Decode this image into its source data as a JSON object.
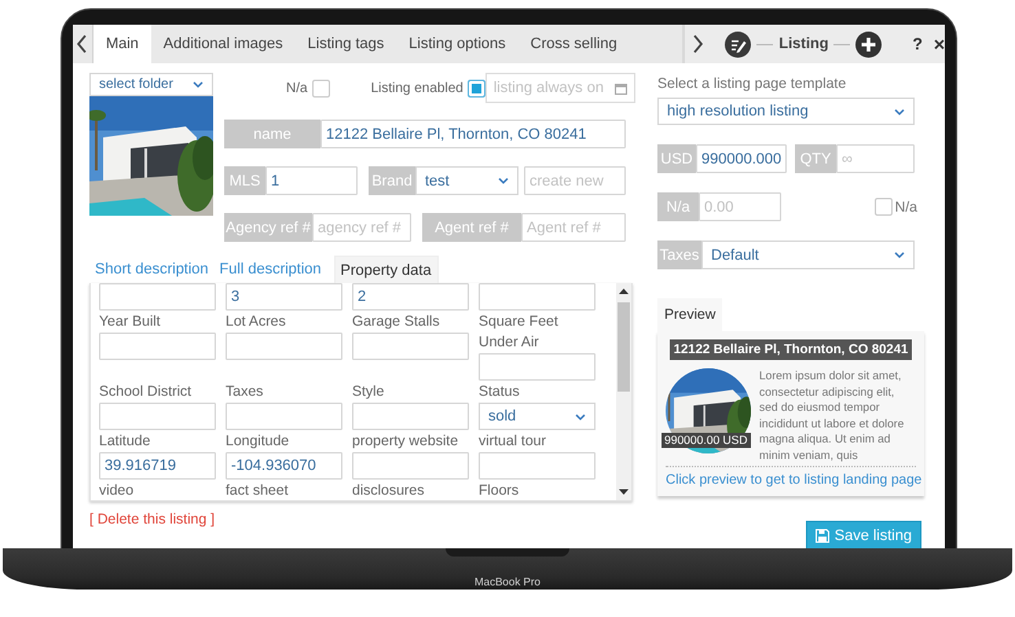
{
  "tabs": [
    {
      "label": "Main",
      "selected": true
    },
    {
      "label": "Additional images",
      "selected": false
    },
    {
      "label": "Listing tags",
      "selected": false
    },
    {
      "label": "Listing options",
      "selected": false
    },
    {
      "label": "Cross selling",
      "selected": false
    }
  ],
  "header": {
    "title": "Listing",
    "help": "?",
    "close": "×"
  },
  "folder_select": {
    "value": "select folder"
  },
  "na_checkbox": {
    "label": "N/a",
    "checked": false
  },
  "enabled_checkbox": {
    "label": "Listing enabled",
    "checked": true
  },
  "availability": {
    "placeholder": "listing always on"
  },
  "name": {
    "label": "name",
    "value": "12122 Bellaire Pl, Thornton, CO 80241"
  },
  "mls": {
    "label": "MLS",
    "value": "1"
  },
  "brand": {
    "label": "Brand",
    "value": "test"
  },
  "new_brand": {
    "placeholder": "create new"
  },
  "agency_ref": {
    "label": "Agency ref #",
    "placeholder": "agency ref #"
  },
  "agent_ref": {
    "label": "Agent ref #",
    "placeholder": "Agent ref #"
  },
  "subtabs": [
    {
      "label": "Short description",
      "selected": false
    },
    {
      "label": "Full description",
      "selected": false
    },
    {
      "label": "Property data",
      "selected": true
    }
  ],
  "property_fields": [
    {
      "kind": "input"
    },
    {
      "kind": "input",
      "value": "3"
    },
    {
      "kind": "input",
      "value": "2"
    },
    {
      "kind": "input"
    },
    {
      "kind": "input",
      "label": "Year Built"
    },
    {
      "kind": "input",
      "label": "Lot Acres"
    },
    {
      "kind": "input",
      "label": "Garage Stalls"
    },
    {
      "kind": "input",
      "label": "Square Feet Under Air"
    },
    {
      "kind": "input",
      "label": "School District"
    },
    {
      "kind": "input",
      "label": "Taxes"
    },
    {
      "kind": "input",
      "label": "Style"
    },
    {
      "kind": "select",
      "label": "Status",
      "value": "sold"
    },
    {
      "kind": "input",
      "label": "Latitude",
      "value": "39.916719"
    },
    {
      "kind": "input",
      "label": "Longitude",
      "value": "-104.936070"
    },
    {
      "kind": "input",
      "label": "property website"
    },
    {
      "kind": "input",
      "label": "virtual tour"
    },
    {
      "kind": "label",
      "label": "video"
    },
    {
      "kind": "label",
      "label": "fact sheet"
    },
    {
      "kind": "label",
      "label": "disclosures"
    },
    {
      "kind": "label",
      "label": "Floors"
    }
  ],
  "delete_link": "[ Delete this listing ]",
  "template": {
    "label": "Select a listing page template",
    "value": "high resolution listing"
  },
  "price": {
    "label": "USD",
    "value": "990000.000"
  },
  "qty": {
    "label": "QTY",
    "placeholder": "∞"
  },
  "discount": {
    "label": "N/a",
    "placeholder": "0.00"
  },
  "na_price": {
    "label": "N/a",
    "checked": false
  },
  "taxes": {
    "label": "Taxes",
    "value": "Default"
  },
  "preview": {
    "tab": "Preview",
    "title": "12122 Bellaire Pl, Thornton, CO 80241",
    "price": "990000.00 USD",
    "text": "Lorem ipsum dolor sit amet, consectetur adipiscing elit, sed do eiusmod tempor incididunt ut labore et dolore magna aliqua. Ut enim ad minim veniam, quis",
    "link": "Click preview to get to listing landing page"
  },
  "save_button": {
    "label": "Save listing"
  },
  "device": {
    "label": "MacBook Pro"
  }
}
